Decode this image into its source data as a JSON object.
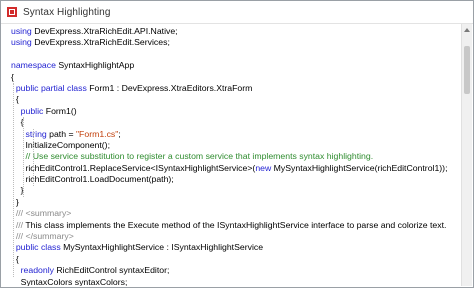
{
  "window": {
    "title": "Syntax Highlighting",
    "icon": "app-red-icon",
    "accent": "#d22b2b"
  },
  "code_lines": [
    [
      {
        "t": "using",
        "c": "kw"
      },
      {
        "t": " DevExpress.XtraRichEdit.API.Native;",
        "c": ""
      }
    ],
    [
      {
        "t": "using",
        "c": "kw"
      },
      {
        "t": " DevExpress.XtraRichEdit.Services;",
        "c": ""
      }
    ],
    [],
    [
      {
        "t": "namespace",
        "c": "kw"
      },
      {
        "t": " SyntaxHighlightApp",
        "c": ""
      }
    ],
    [
      {
        "t": "{",
        "c": ""
      }
    ],
    [
      {
        "t": "  ",
        "c": ""
      },
      {
        "t": "public partial class",
        "c": "kw"
      },
      {
        "t": " Form1 : DevExpress.XtraEditors.XtraForm",
        "c": ""
      }
    ],
    [
      {
        "t": "  {",
        "c": ""
      }
    ],
    [
      {
        "t": "    ",
        "c": ""
      },
      {
        "t": "public",
        "c": "kw"
      },
      {
        "t": " Form1()",
        "c": ""
      }
    ],
    [
      {
        "t": "    {",
        "c": ""
      }
    ],
    [
      {
        "t": "      ",
        "c": ""
      },
      {
        "t": "string",
        "c": "kw"
      },
      {
        "t": " path = ",
        "c": ""
      },
      {
        "t": "\"Form1.cs\"",
        "c": "str"
      },
      {
        "t": ";",
        "c": ""
      }
    ],
    [
      {
        "t": "      InitializeComponent();",
        "c": ""
      }
    ],
    [
      {
        "t": "      ",
        "c": ""
      },
      {
        "t": "// Use service substitution to register a custom service that implements syntax highlighting.",
        "c": "cm"
      }
    ],
    [
      {
        "t": "      richEditControl1.ReplaceService<ISyntaxHighlightService>(",
        "c": ""
      },
      {
        "t": "new",
        "c": "kw"
      },
      {
        "t": " MySyntaxHighlightService(richEditControl1));",
        "c": ""
      }
    ],
    [
      {
        "t": "      richEditControl1.LoadDocument(path);",
        "c": ""
      }
    ],
    [
      {
        "t": "    }",
        "c": ""
      }
    ],
    [
      {
        "t": "  }",
        "c": ""
      }
    ],
    [
      {
        "t": "  ",
        "c": ""
      },
      {
        "t": "///",
        "c": "xmldoc"
      },
      {
        "t": " ",
        "c": ""
      },
      {
        "t": "<summary>",
        "c": "xmldoc"
      }
    ],
    [
      {
        "t": "  ",
        "c": ""
      },
      {
        "t": "///",
        "c": "xmldoc"
      },
      {
        "t": " This class implements the Execute method of the ISyntaxHighlightService interface to parse and colorize text.",
        "c": ""
      }
    ],
    [
      {
        "t": "  ",
        "c": ""
      },
      {
        "t": "///",
        "c": "xmldoc"
      },
      {
        "t": " ",
        "c": ""
      },
      {
        "t": "</summary>",
        "c": "xmldoc"
      }
    ],
    [
      {
        "t": "  ",
        "c": ""
      },
      {
        "t": "public class",
        "c": "kw"
      },
      {
        "t": " MySyntaxHighlightService : ISyntaxHighlightService",
        "c": ""
      }
    ],
    [
      {
        "t": "  {",
        "c": ""
      }
    ],
    [
      {
        "t": "    ",
        "c": ""
      },
      {
        "t": "readonly",
        "c": "kw"
      },
      {
        "t": " RichEditControl syntaxEditor;",
        "c": ""
      }
    ],
    [
      {
        "t": "    SyntaxColors syntaxColors;",
        "c": ""
      }
    ]
  ],
  "colors": {
    "keyword": "#1f1fd1",
    "string": "#c2410c",
    "comment": "#2f8c2f",
    "xmldoc": "#8a8a8a"
  }
}
